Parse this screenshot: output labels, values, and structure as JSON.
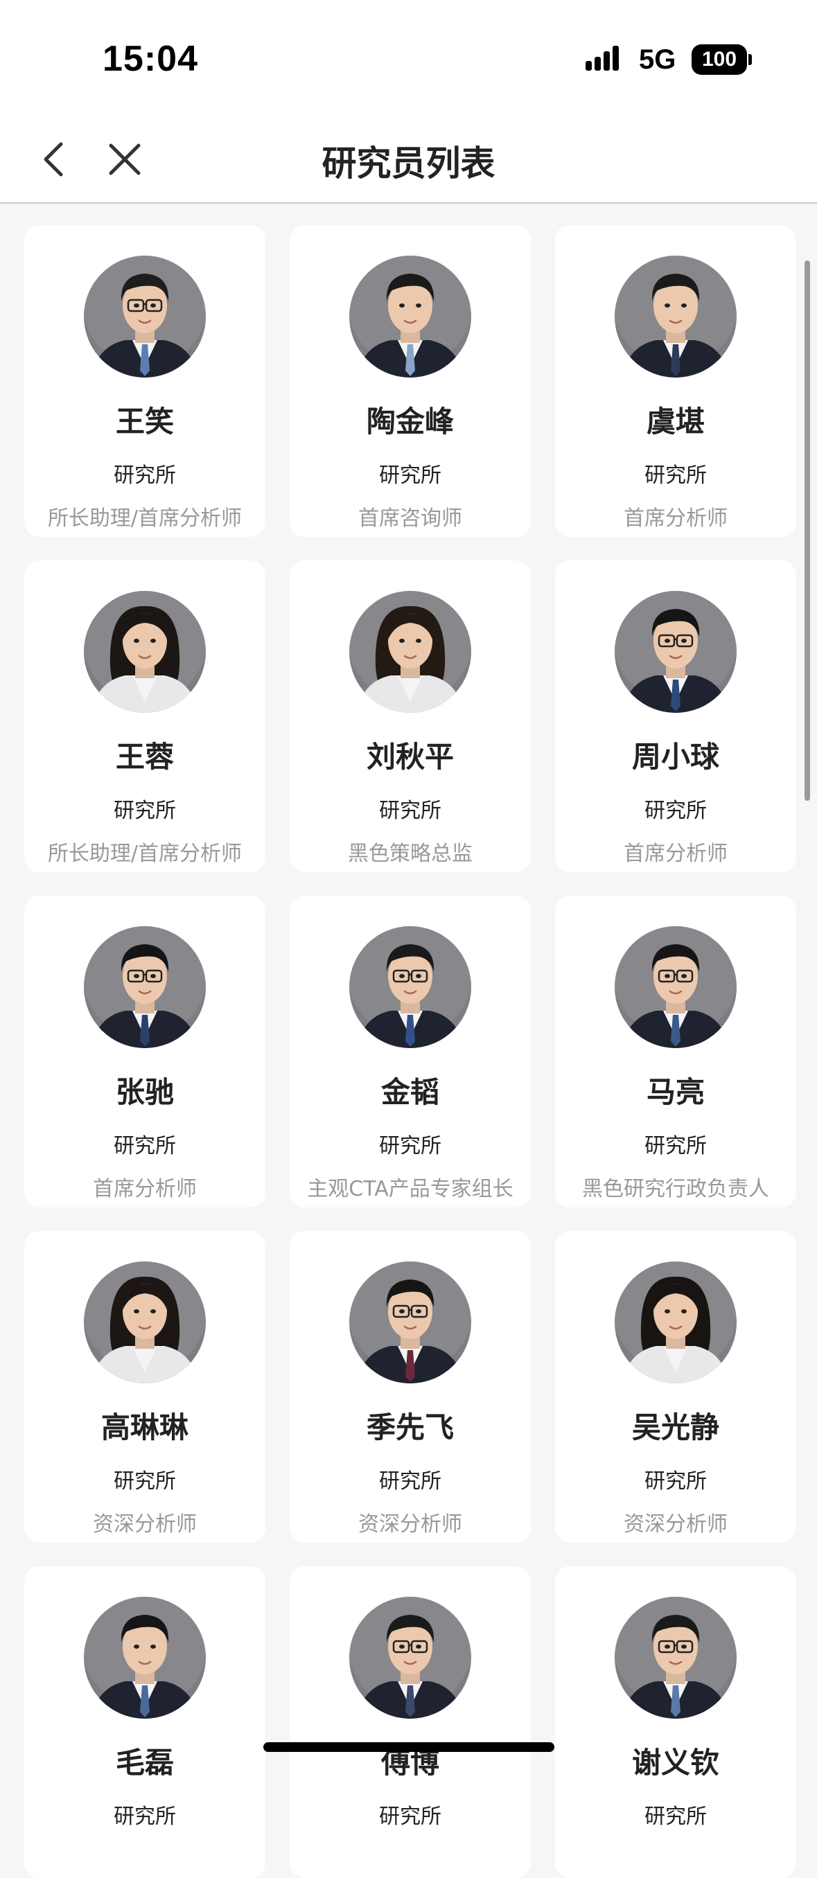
{
  "status_bar": {
    "time": "15:04",
    "network": "5G",
    "battery": "100"
  },
  "nav": {
    "title": "研究员列表",
    "back_icon": "chevron-left-icon",
    "close_icon": "close-icon"
  },
  "researchers": [
    {
      "name": "王笑",
      "dept": "研究所",
      "title": "所长助理/首席分析师",
      "gender": "m",
      "hair": "#1e1e1e",
      "tie": "#5b7fb0",
      "glasses": true
    },
    {
      "name": "陶金峰",
      "dept": "研究所",
      "title": "首席咨询师",
      "gender": "m",
      "hair": "#1a1a1a",
      "tie": "#8aa3c8",
      "glasses": false
    },
    {
      "name": "虞堪",
      "dept": "研究所",
      "title": "首席分析师",
      "gender": "m",
      "hair": "#1a1a1a",
      "tie": "#2b3b58",
      "glasses": false
    },
    {
      "name": "王蓉",
      "dept": "研究所",
      "title": "所长助理/首席分析师",
      "gender": "f",
      "hair": "#1c1714",
      "tie": "#6b8fb8",
      "glasses": false
    },
    {
      "name": "刘秋平",
      "dept": "研究所",
      "title": "黑色策略总监",
      "gender": "f",
      "hair": "#241a14",
      "tie": "#f2f2f2",
      "glasses": false
    },
    {
      "name": "周小球",
      "dept": "研究所",
      "title": "首席分析师",
      "gender": "m",
      "hair": "#151515",
      "tie": "#2d4a7a",
      "glasses": true
    },
    {
      "name": "张驰",
      "dept": "研究所",
      "title": "首席分析师",
      "gender": "m",
      "hair": "#151515",
      "tie": "#2b3f6b",
      "glasses": true
    },
    {
      "name": "金韬",
      "dept": "研究所",
      "title": "主观CTA产品专家组长",
      "gender": "m",
      "hair": "#1a1a1a",
      "tie": "#34508a",
      "glasses": true
    },
    {
      "name": "马亮",
      "dept": "研究所",
      "title": "黑色研究行政负责人",
      "gender": "m",
      "hair": "#151515",
      "tie": "#3a5a8a",
      "glasses": true
    },
    {
      "name": "高琳琳",
      "dept": "研究所",
      "title": "资深分析师",
      "gender": "f",
      "hair": "#1c1714",
      "tie": "#ffffff",
      "glasses": false
    },
    {
      "name": "季先飞",
      "dept": "研究所",
      "title": "资深分析师",
      "gender": "m",
      "hair": "#151515",
      "tie": "#6b2a3a",
      "glasses": true
    },
    {
      "name": "吴光静",
      "dept": "研究所",
      "title": "资深分析师",
      "gender": "f",
      "hair": "#181412",
      "tie": "#ffffff",
      "glasses": false
    },
    {
      "name": "毛磊",
      "dept": "研究所",
      "title": "",
      "gender": "m",
      "hair": "#151515",
      "tie": "#4a6a9a",
      "glasses": false
    },
    {
      "name": "傅博",
      "dept": "研究所",
      "title": "",
      "gender": "m",
      "hair": "#1a1a1a",
      "tie": "#3a4a6a",
      "glasses": true
    },
    {
      "name": "谢义钦",
      "dept": "研究所",
      "title": "",
      "gender": "m",
      "hair": "#1a1a1a",
      "tie": "#5a7aa8",
      "glasses": true
    }
  ]
}
